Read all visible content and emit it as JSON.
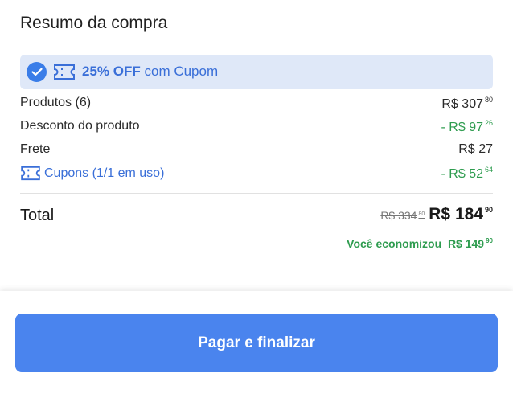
{
  "header": {
    "title": "Resumo da compra"
  },
  "coupon_banner": {
    "discount": "25% OFF",
    "suffix": "com Cupom",
    "icons": [
      "check-icon",
      "ticket-icon"
    ],
    "accent_color": "#3a7de8"
  },
  "summary": {
    "products": {
      "label": "Produtos (6)",
      "value": "R$ 307",
      "cents": "80"
    },
    "product_discount": {
      "label": "Desconto do produto",
      "value": "- R$ 97",
      "cents": "26"
    },
    "shipping": {
      "label": "Frete",
      "value": "R$ 27",
      "cents": ""
    },
    "coupons": {
      "label": "Cupons (1/1 em uso)",
      "value": "- R$ 52",
      "cents": "64",
      "icon": "ticket-icon"
    }
  },
  "total": {
    "label": "Total",
    "old_price": "R$ 334",
    "old_cents": "80",
    "new_price": "R$ 184",
    "new_cents": "90"
  },
  "savings": {
    "label": "Você economizou",
    "value": "R$ 149",
    "cents": "90",
    "color": "#2e9c4f"
  },
  "footer": {
    "pay_button": "Pagar e finalizar",
    "button_color": "#4a84ee"
  }
}
